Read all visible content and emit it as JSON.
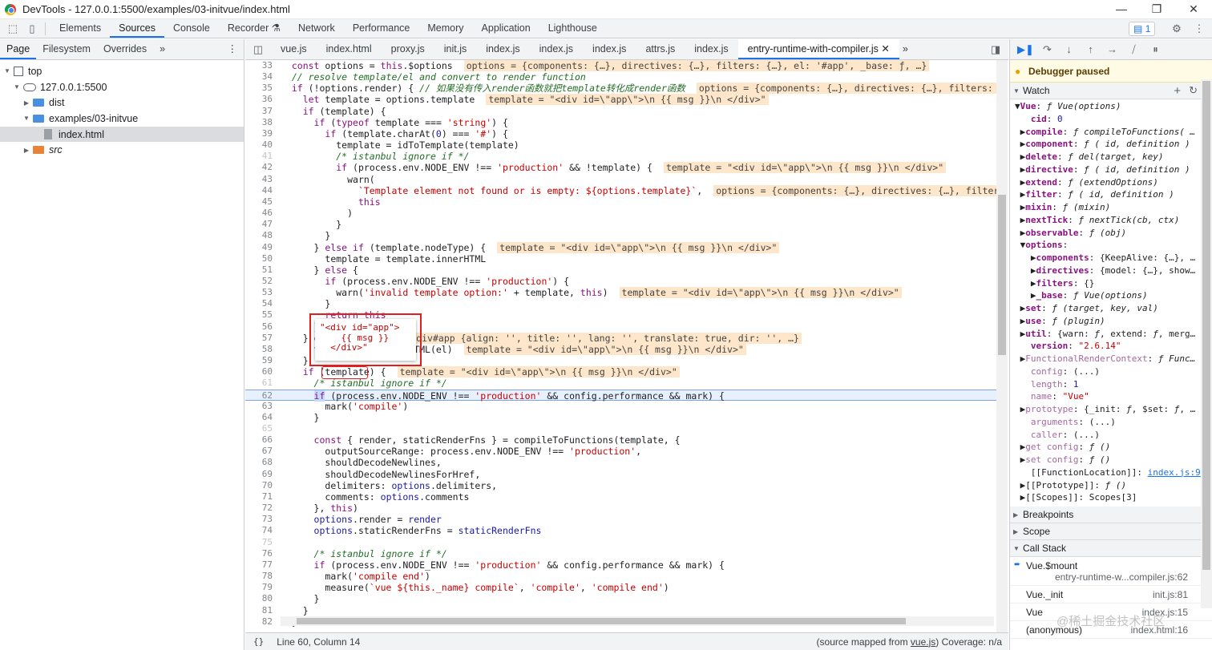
{
  "window": {
    "title": "DevTools - 127.0.0.1:5500/examples/03-initvue/index.html"
  },
  "main_tabs": [
    "Elements",
    "Sources",
    "Console",
    "Recorder",
    "Network",
    "Performance",
    "Memory",
    "Application",
    "Lighthouse"
  ],
  "issues_count": "1",
  "navigator": {
    "tabs": [
      "Page",
      "Filesystem",
      "Overrides"
    ],
    "tree": [
      {
        "label": "top",
        "depth": 0,
        "kind": "top",
        "open": true
      },
      {
        "label": "127.0.0.1:5500",
        "depth": 1,
        "kind": "cloud",
        "open": true
      },
      {
        "label": "dist",
        "depth": 2,
        "kind": "folder",
        "open": false
      },
      {
        "label": "examples/03-initvue",
        "depth": 2,
        "kind": "folder",
        "open": true
      },
      {
        "label": "index.html",
        "depth": 3,
        "kind": "file",
        "selected": true
      },
      {
        "label": "src",
        "depth": 2,
        "kind": "folder-orange",
        "open": false
      }
    ]
  },
  "editor": {
    "file_tabs": [
      "vue.js",
      "index.html",
      "proxy.js",
      "init.js",
      "index.js",
      "index.js",
      "index.js",
      "attrs.js",
      "index.js",
      "entry-runtime-with-compiler.js"
    ],
    "active_tab": "entry-runtime-with-compiler.js",
    "tooltip_lines": [
      "\"<div id=\"app\">",
      "    {{ msg }}",
      "  </div>\""
    ],
    "status": {
      "position": "Line 60, Column 14",
      "source_mapped_prefix": "(source mapped from ",
      "source_mapped_file": "vue.js",
      "source_mapped_suffix": ") Coverage: n/a"
    },
    "lines": [
      {
        "n": "33",
        "html": "  <span class='kw'>const</span> <span class='pl'>options = </span><span class='kw'>this</span><span class='pl'>.$options</span><span class='inl'>options = {components: {…}, directives: {…}, filters: {…}, el: '#app', _base: ƒ, …}</span>"
      },
      {
        "n": "34",
        "html": "  <span class='cm'>// resolve template/el and convert to render function</span>"
      },
      {
        "n": "35",
        "html": "  <span class='kw'>if</span> <span class='pl'>(!options.render) { </span><span class='cm'>// 如果没有传入render函数就把template转化成render函数</span><span class='inl'>options = {components: {…}, directives: {…}, filters: {…}, el</span>"
      },
      {
        "n": "36",
        "html": "    <span class='kw'>let</span> <span class='pl'>template = options.template</span><span class='inl'>template = \"&lt;div id=\\\"app\\\"&gt;\\n {{ msg }}\\n &lt;/div&gt;\"</span>"
      },
      {
        "n": "37",
        "html": "    <span class='kw'>if</span> <span class='pl'>(template) {</span>"
      },
      {
        "n": "38",
        "html": "      <span class='kw'>if</span> <span class='pl'>(</span><span class='kw'>typeof</span> <span class='pl'>template === </span><span class='st'>'string'</span><span class='pl'>) {</span>"
      },
      {
        "n": "39",
        "html": "        <span class='kw'>if</span> <span class='pl'>(template.charAt(</span>0<span class='pl'>) === </span><span class='st'>'#'</span><span class='pl'>) {</span>"
      },
      {
        "n": "40",
        "html": "          <span class='pl'>template = idToTemplate(template)</span>"
      },
      {
        "n": "41",
        "dim": true,
        "html": "          <span class='cm'>/* istanbul ignore if */</span>"
      },
      {
        "n": "42",
        "html": "          <span class='kw'>if</span> <span class='pl'>(process.env.NODE_ENV !== </span><span class='st'>'production'</span><span class='pl'> &amp;&amp; !template) {</span><span class='inl'>template = \"&lt;div id=\\\"app\\\"&gt;\\n {{ msg }}\\n &lt;/div&gt;\"</span>"
      },
      {
        "n": "43",
        "html": "            <span class='pl'>warn(</span>"
      },
      {
        "n": "44",
        "html": "              <span class='st'>`Template element not found or is empty: ${options.template}`</span><span class='pl'>,</span><span class='inl'>options = {components: {…}, directives: {…}, filters: {…}, el</span>"
      },
      {
        "n": "45",
        "html": "              <span class='kw'>this</span>"
      },
      {
        "n": "46",
        "html": "            <span class='pl'>)</span>"
      },
      {
        "n": "47",
        "html": "          <span class='pl'>}</span>"
      },
      {
        "n": "48",
        "html": "        <span class='pl'>}</span>"
      },
      {
        "n": "49",
        "html": "      <span class='pl'>} </span><span class='kw'>else if</span> <span class='pl'>(template.nodeType) {</span><span class='inl'>template = \"&lt;div id=\\\"app\\\"&gt;\\n {{ msg }}\\n &lt;/div&gt;\"</span>"
      },
      {
        "n": "50",
        "html": "        <span class='pl'>template = template.innerHTML</span>"
      },
      {
        "n": "51",
        "html": "      <span class='pl'>} </span><span class='kw'>else</span> <span class='pl'>{</span>"
      },
      {
        "n": "52",
        "html": "        <span class='kw'>if</span> <span class='pl'>(process.env.NODE_ENV !== </span><span class='st'>'production'</span><span class='pl'>) {</span>"
      },
      {
        "n": "53",
        "html": "          <span class='pl'>warn(</span><span class='st'>'invalid template option:'</span><span class='pl'> + template, </span><span class='kw'>this</span><span class='pl'>)</span><span class='inl'>template = \"&lt;div id=\\\"app\\\"&gt;\\n {{ msg }}\\n &lt;/div&gt;\"</span>"
      },
      {
        "n": "54",
        "html": "        <span class='pl'>}</span>"
      },
      {
        "n": "55",
        "html": "        <span class='kw'>return this</span>"
      },
      {
        "n": "56",
        "html": "      <span class='pl'>}</span>"
      },
      {
        "n": "57",
        "html": "    <span class='pl'>} </span><span class='kw'>e</span><span class='pl'>                 </span><span class='inl' style='margin-left:0'>div#app {align: '', title: '', lang: '', translate: true, dir: '', …}</span>"
      },
      {
        "n": "58",
        "html": "      <span class='pl'>t                HTML(el)</span><span class='inl'>template = \"&lt;div id=\\\"app\\\"&gt;\\n {{ msg }}\\n &lt;/div&gt;\"</span>"
      },
      {
        "n": "59",
        "html": "    <span class='pl'>}</span>"
      },
      {
        "n": "60",
        "html": "    <span class='kw'>if</span> <span class='pl'>(template) {</span><span class='inl'>template = \"&lt;div id=\\\"app\\\"&gt;\\n {{ msg }}\\n &lt;/div&gt;\"</span>"
      },
      {
        "n": "61",
        "dim": true,
        "html": "      <span class='cm'>/* istanbul ignore if */</span>"
      },
      {
        "n": "62",
        "hl": true,
        "html": "      <span class='kw' style='background:#c6dafc'>if</span> <span class='pl'>(process.env.NODE_ENV !== </span><span class='st'>'production'</span><span class='pl'> &amp;&amp; config.performance &amp;&amp; mark) {</span>"
      },
      {
        "n": "63",
        "html": "        <span class='pl'>mark(</span><span class='st'>'compile'</span><span class='pl'>)</span>"
      },
      {
        "n": "64",
        "html": "      <span class='pl'>}</span>"
      },
      {
        "n": "65",
        "dim": true,
        "html": ""
      },
      {
        "n": "66",
        "html": "      <span class='kw'>const</span> <span class='pl'>{ render, staticRenderFns } = compileToFunctions(template, {</span>"
      },
      {
        "n": "67",
        "html": "        <span class='pl'>outputSourceRange: process.env.NODE_ENV !== </span><span class='st'>'production'</span><span class='pl'>,</span>"
      },
      {
        "n": "68",
        "html": "        <span class='pl'>shouldDecodeNewlines,</span>"
      },
      {
        "n": "69",
        "html": "        <span class='pl'>shouldDecodeNewlinesForHref,</span>"
      },
      {
        "n": "70",
        "html": "        <span class='pl'>delimiters: </span>options<span class='pl'>.delimiters,</span>"
      },
      {
        "n": "71",
        "html": "        <span class='pl'>comments: </span>options<span class='pl'>.comments</span>"
      },
      {
        "n": "72",
        "html": "      <span class='pl'>}, </span><span class='kw'>this</span><span class='pl'>)</span>"
      },
      {
        "n": "73",
        "html": "      options<span class='pl'>.render = </span>render"
      },
      {
        "n": "74",
        "html": "      options<span class='pl'>.staticRenderFns = </span>staticRenderFns"
      },
      {
        "n": "75",
        "dim": true,
        "html": ""
      },
      {
        "n": "76",
        "html": "      <span class='cm'>/* istanbul ignore if */</span>"
      },
      {
        "n": "77",
        "html": "      <span class='kw'>if</span> <span class='pl'>(process.env.NODE_ENV !== </span><span class='st'>'production'</span><span class='pl'> &amp;&amp; config.performance &amp;&amp; mark) {</span>"
      },
      {
        "n": "78",
        "html": "        <span class='pl'>mark(</span><span class='st'>'compile end'</span><span class='pl'>)</span>"
      },
      {
        "n": "79",
        "html": "        <span class='pl'>measure(</span><span class='st'>`vue ${this._name} compile`</span><span class='pl'>, </span><span class='st'>'compile'</span><span class='pl'>, </span><span class='st'>'compile end'</span><span class='pl'>)</span>"
      },
      {
        "n": "80",
        "html": "      <span class='pl'>}</span>"
      },
      {
        "n": "81",
        "html": "    <span class='pl'>}</span>"
      },
      {
        "n": "82",
        "html": "  <span class='pl'>}</span>"
      }
    ]
  },
  "debugger": {
    "paused_label": "Debugger paused",
    "watch_label": "Watch",
    "watch_lines": [
      "<span class='tri2'>▼</span><span class='wk'>Vue</span>: <span class='fi'>ƒ Vue(options)</span>",
      "&nbsp;&nbsp;&nbsp;<span class='wk'>cid</span>: <span class='num'>0</span>",
      "&nbsp;▶<span class='wk'>compile</span>: <span class='fi'>ƒ compileToFunctions( …</span>",
      "&nbsp;▶<span class='wk'>component</span>: <span class='fi'>ƒ ( id, definition )</span>",
      "&nbsp;▶<span class='wk'>delete</span>: <span class='fi'>ƒ del(target, key)</span>",
      "&nbsp;▶<span class='wk'>directive</span>: <span class='fi'>ƒ ( id, definition )</span>",
      "&nbsp;▶<span class='wk'>extend</span>: <span class='fi'>ƒ (extendOptions)</span>",
      "&nbsp;▶<span class='wk'>filter</span>: <span class='fi'>ƒ ( id, definition )</span>",
      "&nbsp;▶<span class='wk'>mixin</span>: <span class='fi'>ƒ (mixin)</span>",
      "&nbsp;▶<span class='wk'>nextTick</span>: <span class='fi'>ƒ nextTick(cb, ctx)</span>",
      "&nbsp;▶<span class='wk'>observable</span>: <span class='fi'>ƒ (obj)</span>",
      "&nbsp;▼<span class='wk'>options</span>:",
      "&nbsp;&nbsp;&nbsp;▶<span class='wk'>components</span>: {KeepAlive: {…}, …",
      "&nbsp;&nbsp;&nbsp;▶<span class='wk'>directives</span>: {model: {…}, show…",
      "&nbsp;&nbsp;&nbsp;▶<span class='wk'>filters</span>: {}",
      "&nbsp;&nbsp;&nbsp;▶<span class='wk'>_base</span>: <span class='fi'>ƒ Vue(options)</span>",
      "&nbsp;▶<span class='wk'>set</span>: <span class='fi'>ƒ (target, key, val)</span>",
      "&nbsp;▶<span class='wk'>use</span>: <span class='fi'>ƒ (plugin)</span>",
      "&nbsp;▶<span class='wk'>util</span>: {warn: <span class='fi'>ƒ</span>, extend: <span class='fi'>ƒ</span>, merg…",
      "&nbsp;&nbsp;&nbsp;<span class='wk'>version</span>: <span class='str'>\"2.6.14\"</span>",
      "&nbsp;▶<span class='wk dimk'>FunctionalRenderContext</span>: <span class='fi'>ƒ Func…</span>",
      "&nbsp;&nbsp;&nbsp;<span class='wk dimk'>config</span>: (...)",
      "&nbsp;&nbsp;&nbsp;<span class='wk dimk'>length</span>: <span class='num'>1</span>",
      "&nbsp;&nbsp;&nbsp;<span class='wk dimk'>name</span>: <span class='str'>\"Vue\"</span>",
      "&nbsp;▶<span class='wk dimk'>prototype</span>: {_init: <span class='fi'>ƒ</span>, $set: <span class='fi'>ƒ</span>, …",
      "&nbsp;&nbsp;&nbsp;<span class='wk dimk'>arguments</span>: (...)",
      "&nbsp;&nbsp;&nbsp;<span class='wk dimk'>caller</span>: (...)",
      "&nbsp;▶<span class='wk dimk'>get config</span>: <span class='fi'>ƒ ()</span>",
      "&nbsp;▶<span class='wk dimk'>set config</span>: <span class='fi'>ƒ ()</span>",
      "&nbsp;&nbsp;&nbsp;[[FunctionLocation]]: <span class='lnk'>index.js:9</span>",
      "&nbsp;▶[[Prototype]]: <span class='fi'>ƒ ()</span>",
      "&nbsp;▶[[Scopes]]: Scopes[3]"
    ],
    "sections": [
      "Breakpoints",
      "Scope",
      "Call Stack"
    ],
    "call_stack": [
      {
        "fn": "Vue.$mount",
        "loc": "entry-runtime-w...compiler.js:62",
        "current": true
      },
      {
        "fn": "Vue._init",
        "loc": "init.js:81"
      },
      {
        "fn": "Vue",
        "loc": "index.js:15"
      },
      {
        "fn": "(anonymous)",
        "loc": "index.html:16"
      }
    ]
  },
  "watermark": "@稀土掘金技术社区"
}
